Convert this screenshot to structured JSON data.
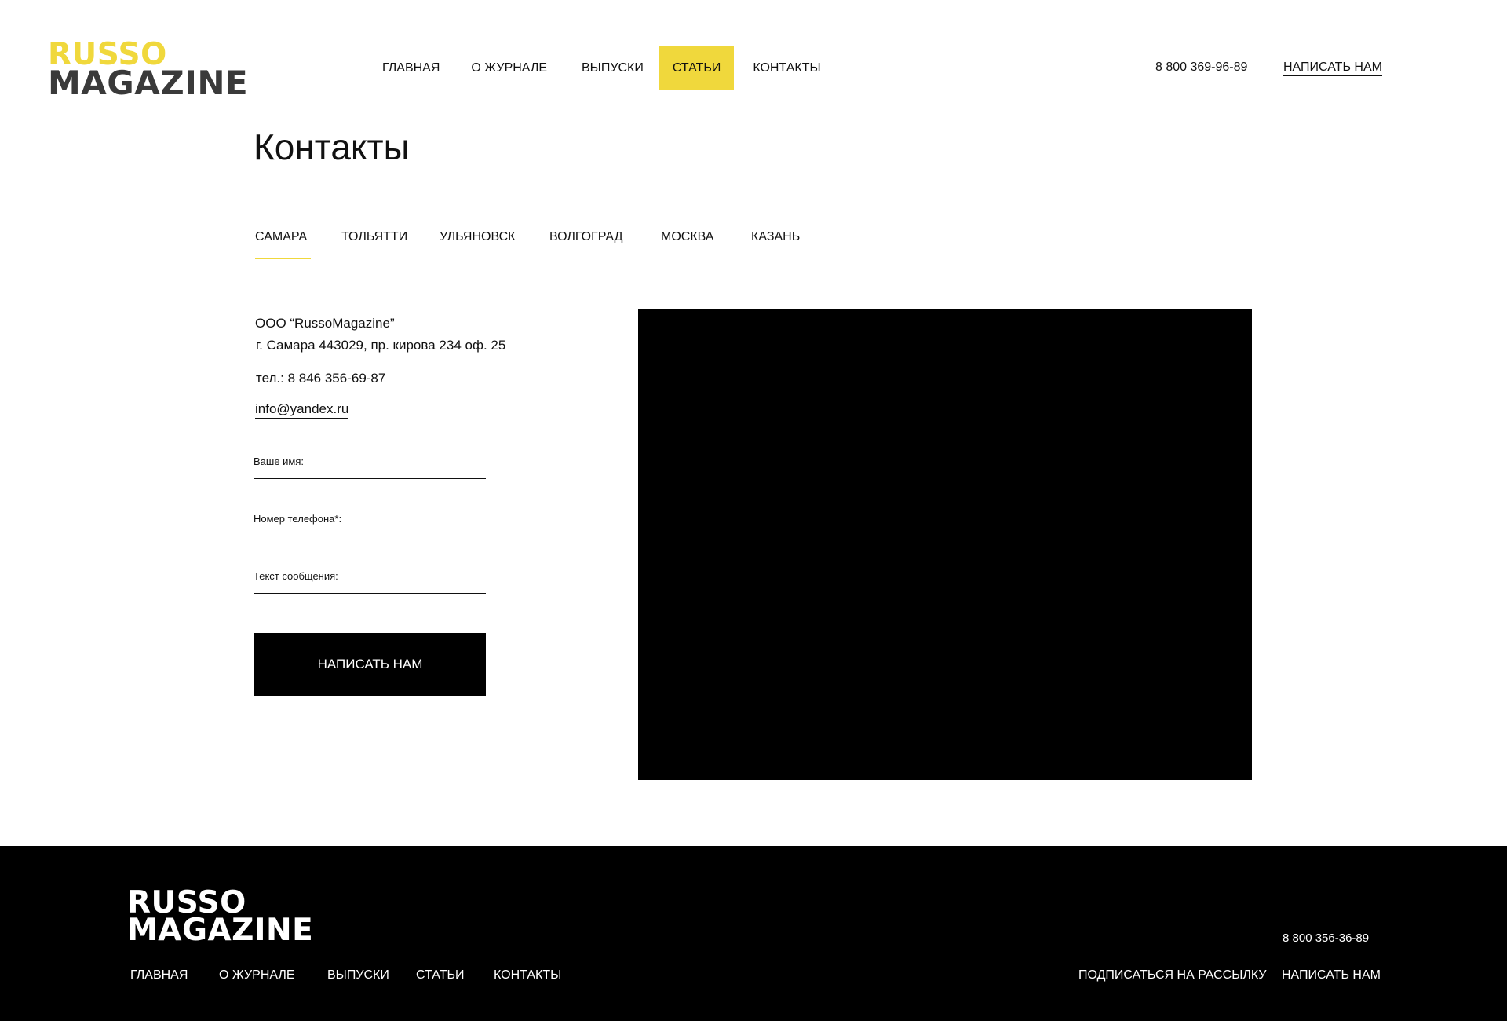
{
  "header": {
    "logo": {
      "line1": "RUSSO",
      "line2": "MAGAZINE"
    },
    "nav": [
      {
        "label": "ГЛАВНАЯ"
      },
      {
        "label": "О ЖУРНАЛЕ"
      },
      {
        "label": "ВЫПУСКИ"
      },
      {
        "label": "СТАТЬИ",
        "active": true
      },
      {
        "label": "КОНТАКТЫ"
      }
    ],
    "phone": "8 800 369-96-89",
    "write_us": "НАПИСАТЬ НАМ"
  },
  "page": {
    "title": "Контакты"
  },
  "tabs": [
    {
      "label": "САМАРА",
      "active": true
    },
    {
      "label": "ТОЛЬЯТТИ"
    },
    {
      "label": "УЛЬЯНОВСК"
    },
    {
      "label": "ВОЛГОГРАД"
    },
    {
      "label": "МОСКВА"
    },
    {
      "label": "КАЗАНЬ"
    }
  ],
  "contacts": {
    "company": "ООО “RussoMagazine”",
    "address": "г. Самара 443029, пр. кирова 234 оф. 25",
    "phone": "тел.: 8 846 356-69-87",
    "email": "info@yandex.ru"
  },
  "form": {
    "name_label": "Ваше имя:",
    "phone_label": "Номер телефона*:",
    "message_label": "Текст сообщения:",
    "name_value": "",
    "phone_value": "",
    "message_value": "",
    "submit_label": "НАПИСАТЬ НАМ"
  },
  "footer": {
    "logo": {
      "line1": "RUSSO",
      "line2": "MAGAZINE"
    },
    "nav": [
      {
        "label": "ГЛАВНАЯ"
      },
      {
        "label": "О ЖУРНАЛЕ"
      },
      {
        "label": "ВЫПУСКИ"
      },
      {
        "label": "СТАТЬИ"
      },
      {
        "label": "КОНТАКТЫ"
      }
    ],
    "phone": "8 800 356-36-89",
    "subscribe": "ПОДПИСАТЬСЯ НА РАССЫЛКУ",
    "write_us": "НАПИСАТЬ НАМ"
  },
  "colors": {
    "accent": "#f0d83c",
    "logo_dark": "#3a3a3a",
    "footer_bg": "#000000",
    "map_bg": "#000000"
  }
}
